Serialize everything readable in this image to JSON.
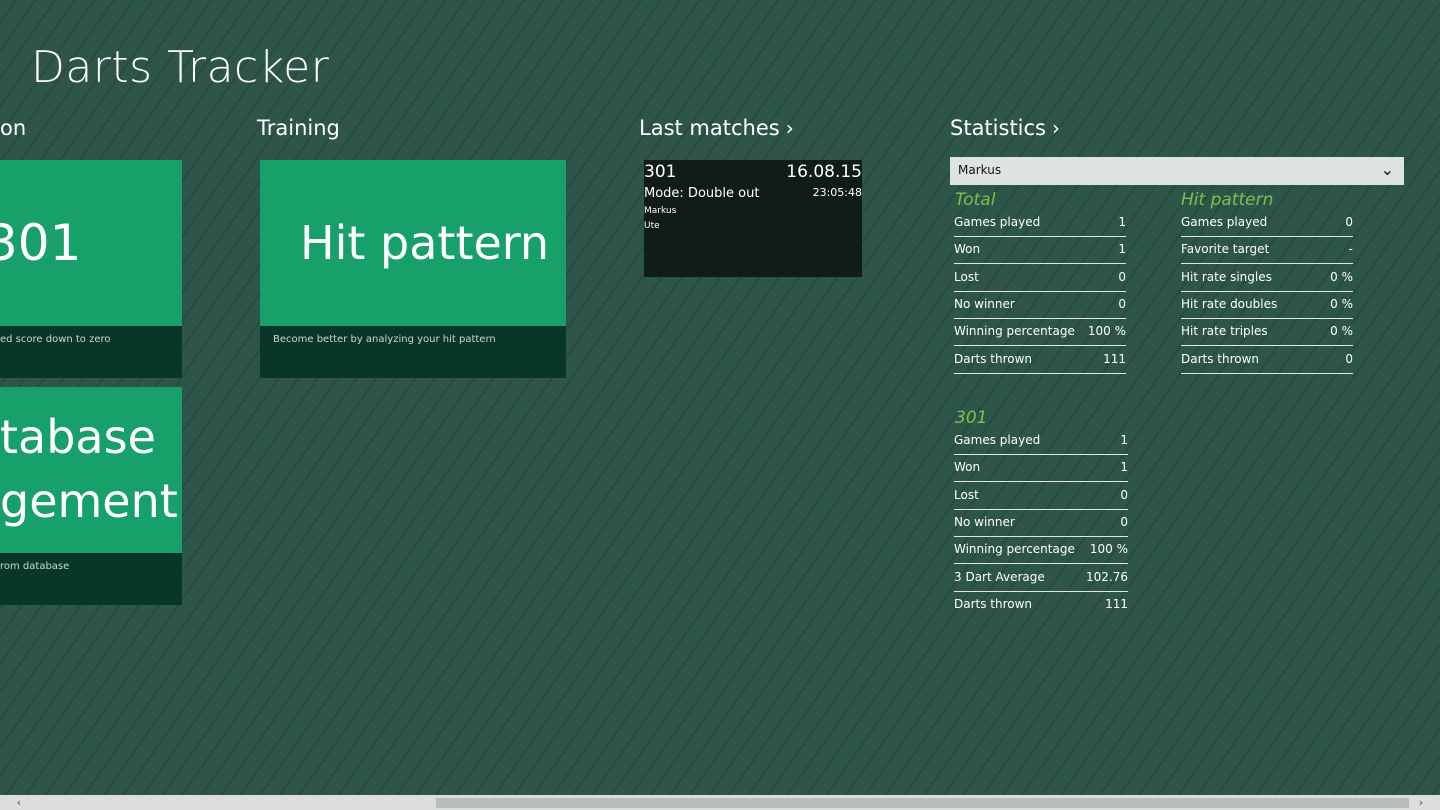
{
  "app": {
    "title": "Darts Tracker"
  },
  "sections": {
    "competition_partial": "on",
    "training": "Training",
    "last_matches": "Last matches",
    "statistics": "Statistics"
  },
  "chevron": "›",
  "tiles": {
    "t301": {
      "title": "301",
      "desc": "ed score down to zero"
    },
    "database": {
      "line1": "tabase",
      "line2": "gement",
      "desc": "rom database"
    },
    "hit_pattern": {
      "title": "Hit pattern",
      "desc": "Become better by analyzing your hit pattern"
    }
  },
  "match": {
    "game": "301",
    "date": "16.08.15",
    "mode": "Mode: Double out",
    "time": "23:05:48",
    "player1": "Markus",
    "player2": "Ute"
  },
  "player_select": {
    "value": "Markus",
    "chevron": "⌄"
  },
  "stats": {
    "total": {
      "title": "Total",
      "rows": [
        {
          "label": "Games played",
          "value": "1"
        },
        {
          "label": "Won",
          "value": "1"
        },
        {
          "label": "Lost",
          "value": "0"
        },
        {
          "label": "No winner",
          "value": "0"
        },
        {
          "label": "Winning percentage",
          "value": "100 %"
        },
        {
          "label": "Darts thrown",
          "value": "111"
        }
      ]
    },
    "hit_pattern": {
      "title": "Hit pattern",
      "rows": [
        {
          "label": "Games played",
          "value": "0"
        },
        {
          "label": "Favorite target",
          "value": "-"
        },
        {
          "label": "Hit rate singles",
          "value": "0 %"
        },
        {
          "label": "Hit rate doubles",
          "value": "0 %"
        },
        {
          "label": "Hit rate triples",
          "value": "0 %"
        },
        {
          "label": "Darts thrown",
          "value": "0"
        }
      ]
    },
    "game301": {
      "title": "301",
      "rows": [
        {
          "label": "Games played",
          "value": "1"
        },
        {
          "label": "Won",
          "value": "1"
        },
        {
          "label": "Lost",
          "value": "0"
        },
        {
          "label": "No winner",
          "value": "0"
        },
        {
          "label": "Winning percentage",
          "value": "100 %"
        },
        {
          "label": "3 Dart Average",
          "value": "102.76"
        },
        {
          "label": "Darts thrown",
          "value": "111"
        }
      ]
    }
  },
  "scrollbar": {
    "left_arrow": "‹",
    "right_arrow": "›"
  },
  "colors": {
    "background": "#2e5549",
    "tile": "#17a06a",
    "tile_footer": "#08372a",
    "accent": "#7fc04a"
  }
}
